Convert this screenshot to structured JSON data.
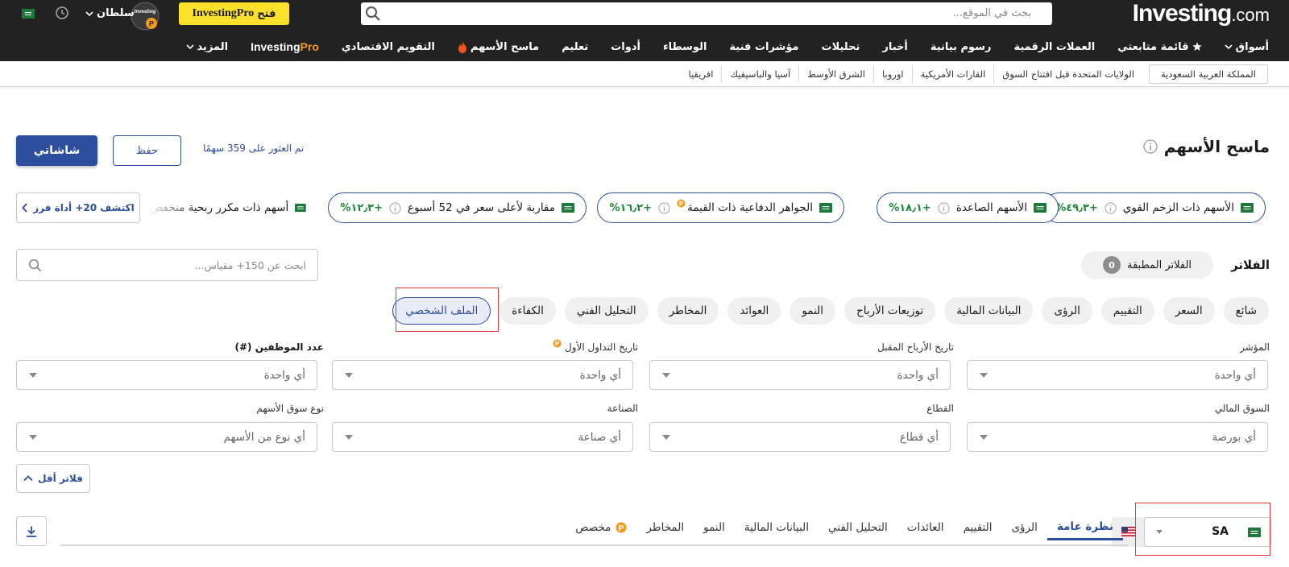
{
  "header": {
    "logo_bold": "Investing",
    "logo_suffix": ".com",
    "search_placeholder": "بحث في الموقع...",
    "pro_button_label": "فتح",
    "pro_button_brand": "InvestingPro",
    "username": "سلطان",
    "avatar_text": "Investing"
  },
  "nav": {
    "items": [
      "أسواق",
      "قائمة متابعتي",
      "العملات الرقمية",
      "رسوم بيانية",
      "أخبار",
      "تحليلات",
      "مؤشرات فنية",
      "الوسطاء",
      "أدوات",
      "تعليم",
      "ماسح الأسهم",
      "التقويم الاقتصادي"
    ],
    "pro_investing": "Investing",
    "pro_suffix": "Pro",
    "more": "المزيد"
  },
  "subnav": {
    "items": [
      "المملكة العربية السعودية",
      "الولايات المتحدة قبل افتتاح السوق",
      "القارات الأمريكية",
      "اوروبا",
      "الشرق الأوسط",
      "آسيا والباسيفيك",
      "افريقيا"
    ]
  },
  "page": {
    "title": "ماسح الأسهم",
    "found_text": "تم العثور على 359 سهمًا",
    "save_label": "حفظ",
    "share_label": "شاشاتي"
  },
  "presets": [
    {
      "label": "الأسهم ذات الزخم القوي",
      "pct": "+٤٩٫٣%"
    },
    {
      "label": "الأسهم الصاعدة",
      "pct": "+١٨٫١%"
    },
    {
      "label": "الجواهر الدفاعية ذات القيمة",
      "pct": "+١٦٫٢%"
    },
    {
      "label": "مقاربة لأعلى سعر في 52 أسبوع",
      "pct": "+١٢٫٣%"
    },
    {
      "label": "أسهم ذات مكرر ربحية منخفض"
    }
  ],
  "discover_label": "اكتشف 20+ أداة فرز",
  "filters": {
    "title": "الفلاتر",
    "applied_label": "الفلاتر المطبقة",
    "applied_count": "0",
    "metric_search_placeholder": "ابحث عن 150+ مقياس...",
    "categories": [
      "شائع",
      "السعر",
      "التقييم",
      "الرؤى",
      "البيانات المالية",
      "توزيعات الأرباح",
      "النمو",
      "العوائد",
      "المخاطر",
      "التحليل الفني",
      "الكفاءة",
      "الملف الشخصي"
    ],
    "fields": [
      {
        "label": "المؤشر",
        "value": "أي واحدة"
      },
      {
        "label": "تاريخ الأرباح المقبل",
        "value": "أي واحدة"
      },
      {
        "label": "تاريخ التداول الأول",
        "value": "أي واحدة"
      },
      {
        "label": "عدد الموظفين (#)",
        "value": "أي واحدة"
      },
      {
        "label": "السوق المالي",
        "value": "أي بورصة"
      },
      {
        "label": "القطاع",
        "value": "أي قطاع"
      },
      {
        "label": "الصناعة",
        "value": "أي صناعة"
      },
      {
        "label": "نوع سوق الأسهم",
        "value": "أي نوع من الأسهم"
      }
    ],
    "fewer_label": "فلاتر أقل"
  },
  "results": {
    "market": "SA",
    "tabs": [
      "نظرة عامة",
      "الرؤى",
      "التقييم",
      "العائدات",
      "التحليل الفني",
      "البيانات المالية",
      "النمو",
      "المخاطر",
      "مخصص"
    ]
  },
  "colors": {
    "header_bg": "#222222",
    "accent": "#2d4e9d",
    "pro_yellow": "#fce12c",
    "positive": "#1f8b3a",
    "highlight_red": "#e53935",
    "pro_orange": "#f39a1d"
  }
}
